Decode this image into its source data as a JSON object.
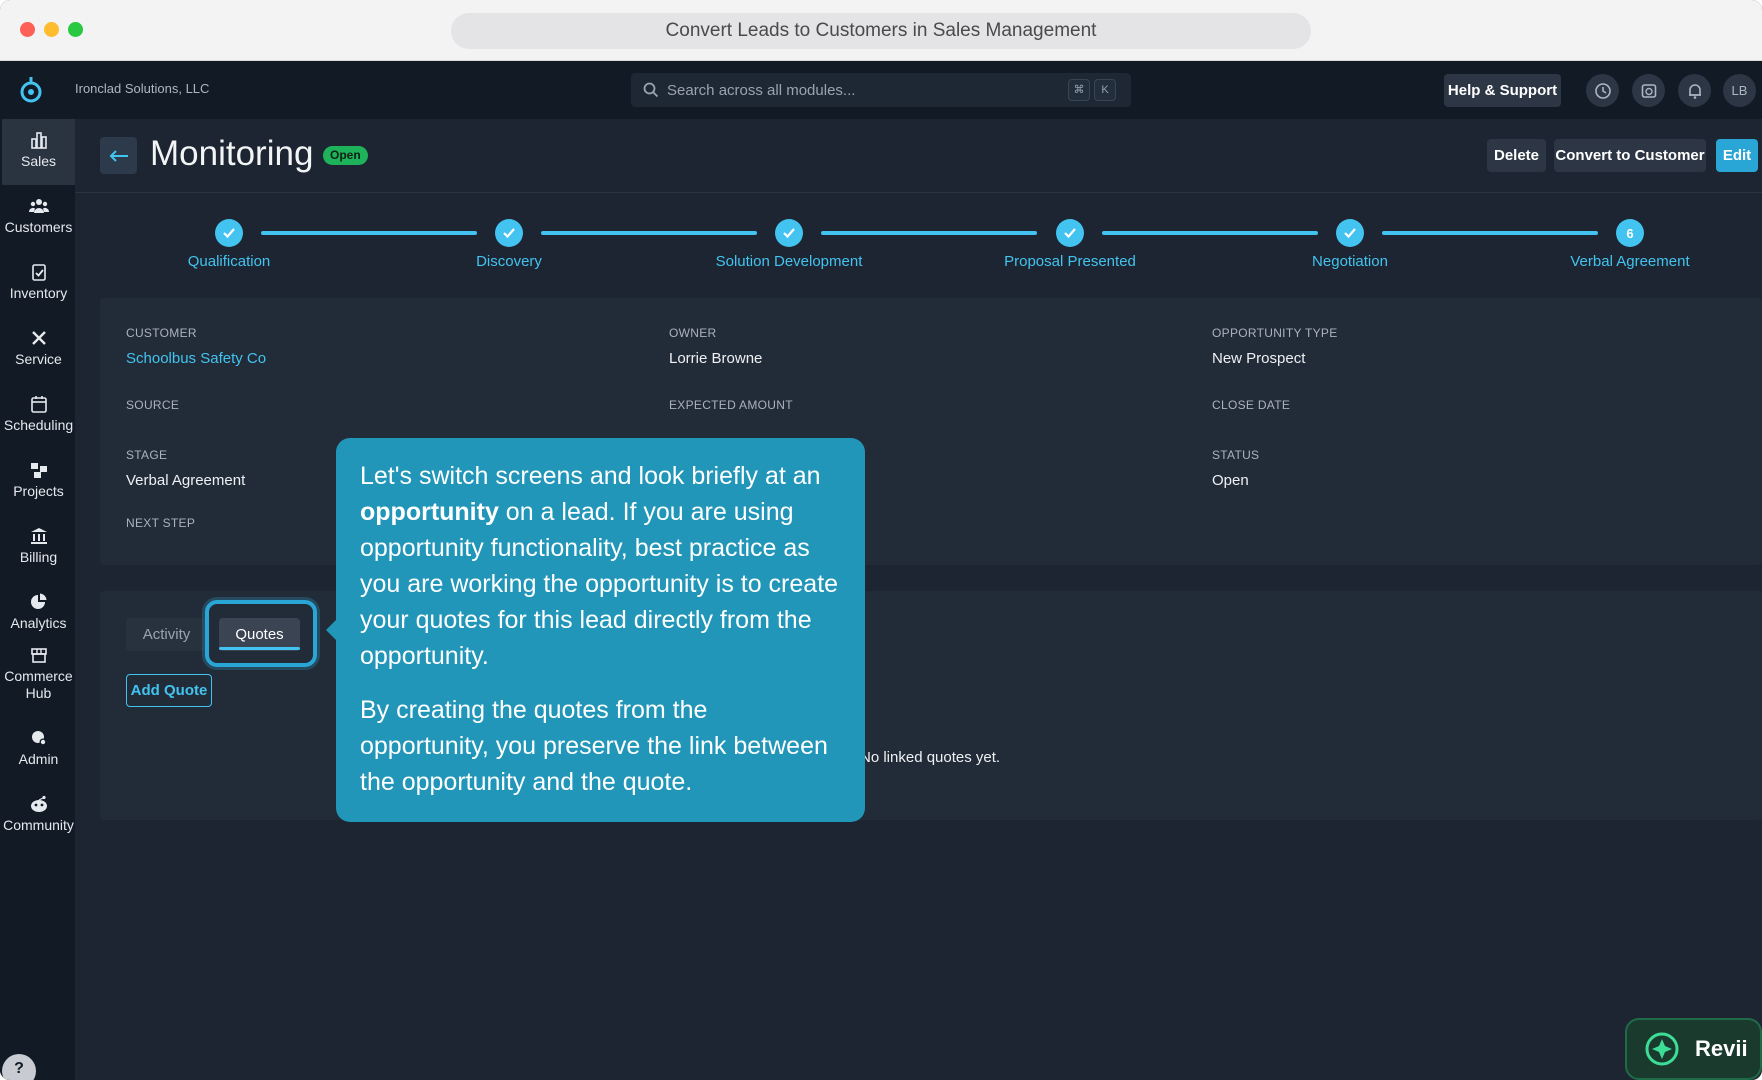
{
  "browser": {
    "url_title": "Convert Leads to Customers in Sales Management"
  },
  "topbar": {
    "company": "Ironclad Solutions, LLC",
    "search_placeholder": "Search across all modules...",
    "shortcut_key1": "⌘",
    "shortcut_key2": "K",
    "help_label": "Help & Support",
    "avatar_initials": "LB"
  },
  "sidebar": {
    "items": [
      {
        "label": "Sales",
        "icon": "bar-chart-icon"
      },
      {
        "label": "Customers",
        "icon": "users-icon"
      },
      {
        "label": "Inventory",
        "icon": "clipboard-check-icon"
      },
      {
        "label": "Service",
        "icon": "wrench-icon"
      },
      {
        "label": "Scheduling",
        "icon": "calendar-icon"
      },
      {
        "label": "Projects",
        "icon": "projects-icon"
      },
      {
        "label": "Billing",
        "icon": "bank-icon"
      },
      {
        "label": "Analytics",
        "icon": "pie-chart-icon"
      },
      {
        "label": "Commerce Hub",
        "icon": "store-icon"
      },
      {
        "label": "Admin",
        "icon": "admin-icon"
      },
      {
        "label": "Community",
        "icon": "community-icon"
      }
    ],
    "help_glyph": "?"
  },
  "header": {
    "title": "Monitoring",
    "status": "Open",
    "delete_label": "Delete",
    "convert_label": "Convert to Customer",
    "edit_label": "Edit"
  },
  "stepper": {
    "steps": [
      {
        "label": "Qualification",
        "state": "done"
      },
      {
        "label": "Discovery",
        "state": "done"
      },
      {
        "label": "Solution Development",
        "state": "done"
      },
      {
        "label": "Proposal Presented",
        "state": "done"
      },
      {
        "label": "Negotiation",
        "state": "done"
      },
      {
        "label": "Verbal Agreement",
        "state": "current",
        "number": "6"
      }
    ],
    "accent": "#43c3ef"
  },
  "details": {
    "customer_label": "CUSTOMER",
    "customer_value": "Schoolbus Safety Co",
    "owner_label": "OWNER",
    "owner_value": "Lorrie Browne",
    "opp_type_label": "OPPORTUNITY TYPE",
    "opp_type_value": "New Prospect",
    "source_label": "SOURCE",
    "expected_amount_label": "EXPECTED AMOUNT",
    "close_date_label": "CLOSE DATE",
    "stage_label": "STAGE",
    "stage_value": "Verbal Agreement",
    "status_label": "STATUS",
    "status_value": "Open",
    "next_step_label": "NEXT STEP"
  },
  "tabs": {
    "activity_label": "Activity",
    "quotes_label": "Quotes",
    "add_quote_label": "Add Quote",
    "empty_text": "No linked quotes yet."
  },
  "tooltip": {
    "p1_start": "Let's switch screens and look briefly at an ",
    "p1_bold": "opportunity",
    "p1_end": " on a lead. If you are using opportunity functionality, best practice as you are working the opportunity is to create your quotes for this lead directly from the opportunity.",
    "p2": "By creating the quotes from the opportunity, you preserve the link between the opportunity and the quote."
  },
  "revii": {
    "label": "Revii"
  }
}
